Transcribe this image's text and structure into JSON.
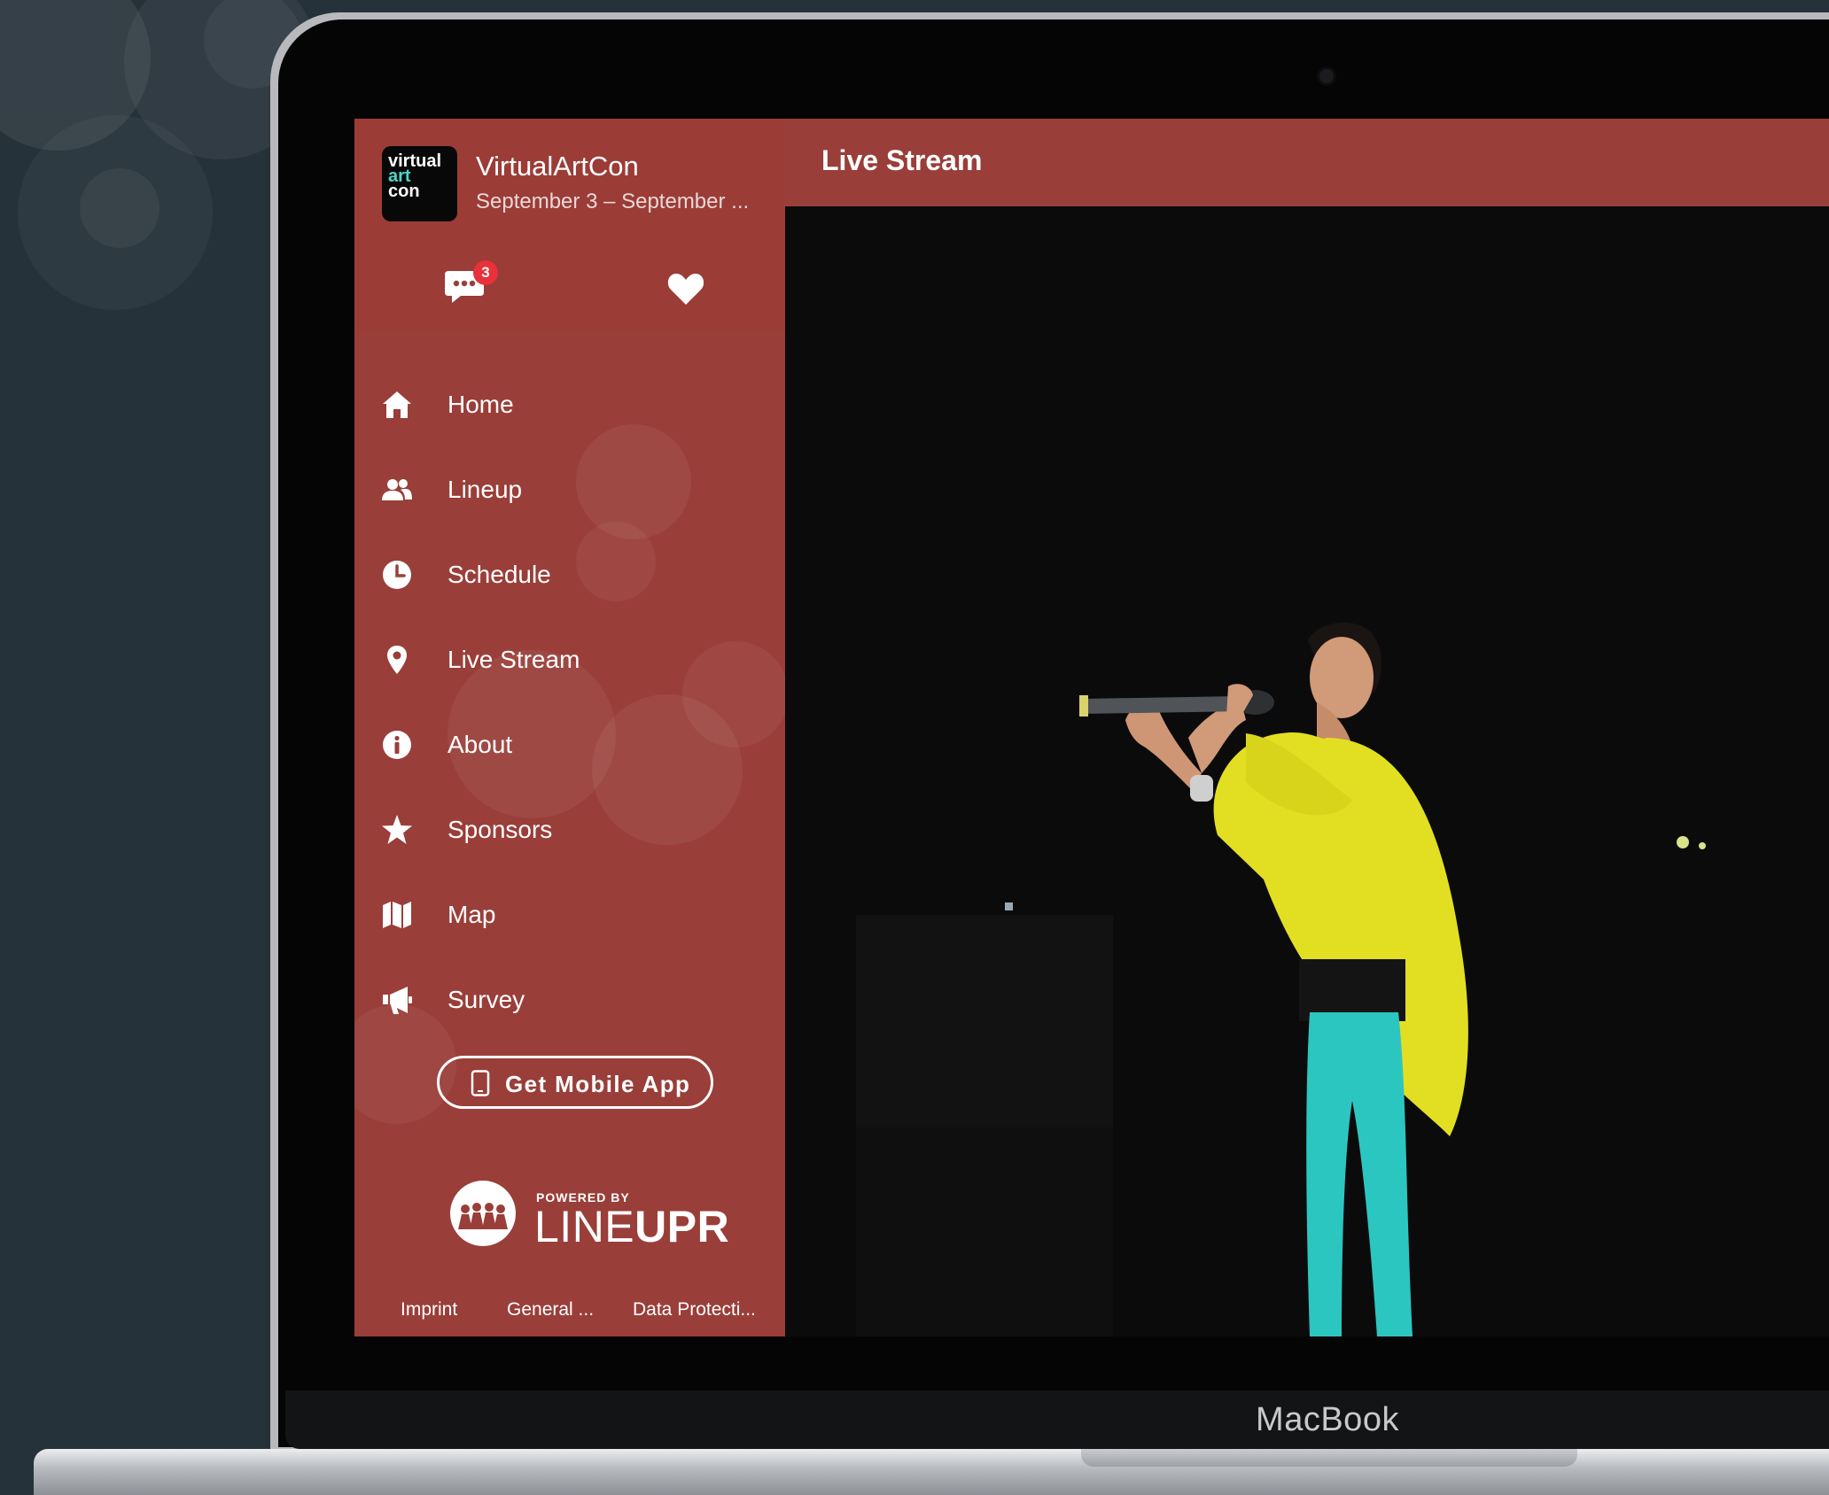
{
  "device": {
    "brand_label": "MacBook"
  },
  "event": {
    "logo_lines": [
      "virtual",
      "art",
      "con"
    ],
    "title": "VirtualArtCon",
    "dates": "September 3 – September ..."
  },
  "quick_actions": {
    "messages_icon": "chat-bubble-icon",
    "messages_badge": "3",
    "favorites_icon": "heart-icon"
  },
  "nav": {
    "items": [
      {
        "label": "Home",
        "icon": "home-icon"
      },
      {
        "label": "Lineup",
        "icon": "users-icon"
      },
      {
        "label": "Schedule",
        "icon": "clock-icon"
      },
      {
        "label": "Live Stream",
        "icon": "map-pin-icon"
      },
      {
        "label": "About",
        "icon": "info-icon"
      },
      {
        "label": "Sponsors",
        "icon": "star-icon"
      },
      {
        "label": "Map",
        "icon": "map-icon"
      },
      {
        "label": "Survey",
        "icon": "megaphone-icon"
      }
    ]
  },
  "mobile_app_button": {
    "label": "Get Mobile App",
    "icon": "phone-icon"
  },
  "powered_by": {
    "prefix": "POWERED BY",
    "brand_light": "LINE",
    "brand_bold": "UPR"
  },
  "footer": {
    "links": [
      "Imprint",
      "General ...",
      "Data Protecti..."
    ]
  },
  "main": {
    "page_title": "Live Stream"
  },
  "colors": {
    "accent": "#9a3e39",
    "badge": "#e8313a",
    "logo_accent": "#4bd6c8"
  }
}
